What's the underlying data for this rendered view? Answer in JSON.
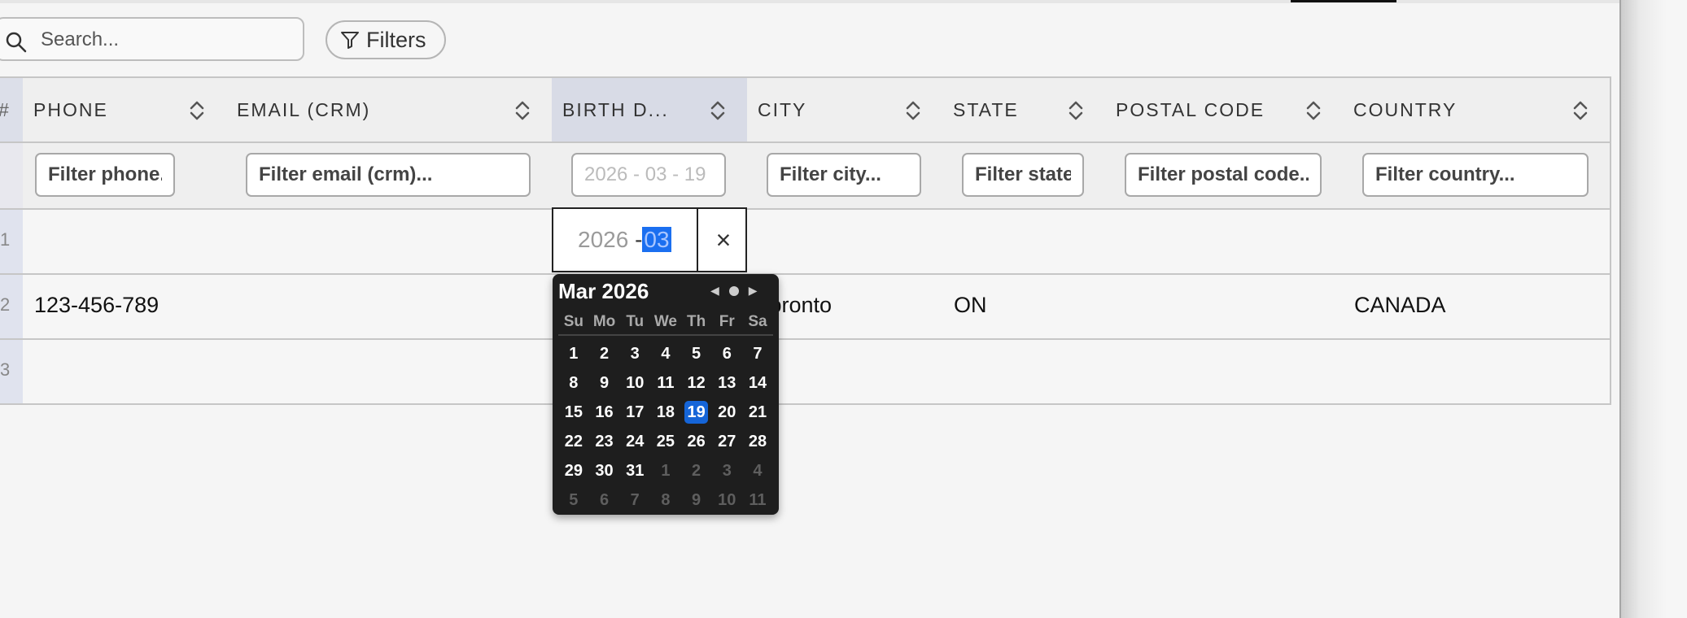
{
  "toolbar": {
    "search_placeholder": "Search...",
    "filters_label": "Filters"
  },
  "columns": [
    {
      "key": "rownum",
      "label": "#"
    },
    {
      "key": "phone",
      "label": "PHONE",
      "filter_placeholder": "Filter phone..."
    },
    {
      "key": "email",
      "label": "EMAIL (CRM)",
      "filter_placeholder": "Filter email (crm)..."
    },
    {
      "key": "birth",
      "label": "BIRTH D...",
      "filter_value": "2026 - 03 - 19"
    },
    {
      "key": "city",
      "label": "CITY",
      "filter_placeholder": "Filter city..."
    },
    {
      "key": "state",
      "label": "STATE",
      "filter_placeholder": "Filter state..."
    },
    {
      "key": "postal",
      "label": "POSTAL CODE",
      "filter_placeholder": "Filter postal code..."
    },
    {
      "key": "country",
      "label": "COUNTRY",
      "filter_placeholder": "Filter country..."
    }
  ],
  "rows": [
    {
      "rownum": "1",
      "phone": "",
      "email": "",
      "birth": "",
      "city": "",
      "state": "",
      "postal": "",
      "country": ""
    },
    {
      "rownum": "2",
      "phone": "123-456-789",
      "email": "",
      "birth": "",
      "city": "Toronto",
      "state": "ON",
      "postal": "",
      "country": "CANADA"
    },
    {
      "rownum": "3",
      "phone": "",
      "email": "",
      "birth": "",
      "city": "",
      "state": "",
      "postal": "",
      "country": ""
    }
  ],
  "date_editor": {
    "year": "2026",
    "sep": "-",
    "month": "03",
    "clear_label": "×"
  },
  "calendar": {
    "title": "Mar 2026",
    "weekdays": [
      "Su",
      "Mo",
      "Tu",
      "We",
      "Th",
      "Fr",
      "Sa"
    ],
    "days": [
      {
        "d": "1"
      },
      {
        "d": "2"
      },
      {
        "d": "3"
      },
      {
        "d": "4"
      },
      {
        "d": "5"
      },
      {
        "d": "6"
      },
      {
        "d": "7"
      },
      {
        "d": "8"
      },
      {
        "d": "9"
      },
      {
        "d": "10"
      },
      {
        "d": "11"
      },
      {
        "d": "12"
      },
      {
        "d": "13"
      },
      {
        "d": "14"
      },
      {
        "d": "15"
      },
      {
        "d": "16"
      },
      {
        "d": "17"
      },
      {
        "d": "18"
      },
      {
        "d": "19",
        "selected": true
      },
      {
        "d": "20"
      },
      {
        "d": "21"
      },
      {
        "d": "22"
      },
      {
        "d": "23"
      },
      {
        "d": "24"
      },
      {
        "d": "25"
      },
      {
        "d": "26"
      },
      {
        "d": "27"
      },
      {
        "d": "28"
      },
      {
        "d": "29"
      },
      {
        "d": "30"
      },
      {
        "d": "31"
      },
      {
        "d": "1",
        "other": true
      },
      {
        "d": "2",
        "other": true
      },
      {
        "d": "3",
        "other": true
      },
      {
        "d": "4",
        "other": true
      },
      {
        "d": "5",
        "other": true
      },
      {
        "d": "6",
        "other": true
      },
      {
        "d": "7",
        "other": true
      },
      {
        "d": "8",
        "other": true
      },
      {
        "d": "9",
        "other": true
      },
      {
        "d": "10",
        "other": true
      },
      {
        "d": "11",
        "other": true
      }
    ]
  },
  "colors": {
    "accent": "#1565d8",
    "highlighted_header": "#d8dbe6"
  }
}
